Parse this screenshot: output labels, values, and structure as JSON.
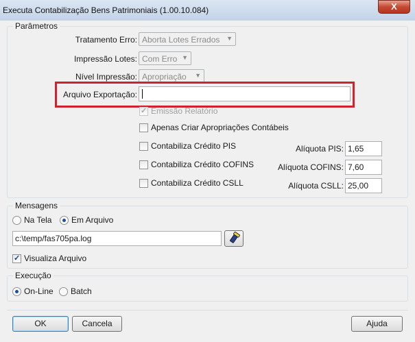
{
  "window": {
    "title": "Executa Contabilização Bens Patrimoniais (1.00.10.084)",
    "close_glyph": "X"
  },
  "parametros": {
    "legend": "Parâmetros",
    "tratamento_erro": {
      "label": "Tratamento Erro:",
      "value": "Aborta Lotes Errados"
    },
    "impressao_lotes": {
      "label": "Impressão Lotes:",
      "value": "Com Erro"
    },
    "nivel_impressao": {
      "label": "Nível Impressão:",
      "value": "Apropriação"
    },
    "arquivo_exportacao": {
      "label": "Arquivo Exportação:",
      "value": ""
    },
    "emissao_relatorio": {
      "label": "Emissão Relatório",
      "checked": true,
      "enabled": false
    },
    "apenas_criar": {
      "label": "Apenas Criar Apropriações Contábeis",
      "checked": false
    },
    "credito_pis": {
      "label": "Contabiliza Crédito PIS",
      "checked": false,
      "aliquota_label": "Alíquota PIS:",
      "aliquota_value": "1,65"
    },
    "credito_cofins": {
      "label": "Contabiliza Crédito COFINS",
      "checked": false,
      "aliquota_label": "Alíquota COFINS:",
      "aliquota_value": "7,60"
    },
    "credito_csll": {
      "label": "Contabiliza Crédito CSLL",
      "checked": false,
      "aliquota_label": "Alíquota CSLL:",
      "aliquota_value": "25,00"
    }
  },
  "mensagens": {
    "legend": "Mensagens",
    "na_tela": "Na Tela",
    "em_arquivo": "Em Arquivo",
    "selected": "em_arquivo",
    "file_path": "c:\\temp/fas705pa.log",
    "visualiza_arquivo": {
      "label": "Visualiza Arquivo",
      "checked": true
    }
  },
  "execucao": {
    "legend": "Execução",
    "online": "On-Line",
    "batch": "Batch",
    "selected": "online"
  },
  "footer": {
    "ok": "OK",
    "cancela": "Cancela",
    "ajuda": "Ajuda"
  },
  "colors": {
    "highlight": "#d0222e",
    "close": "#c54a33"
  },
  "icons": {
    "browse": "flashlight-icon",
    "check": "check-icon"
  }
}
